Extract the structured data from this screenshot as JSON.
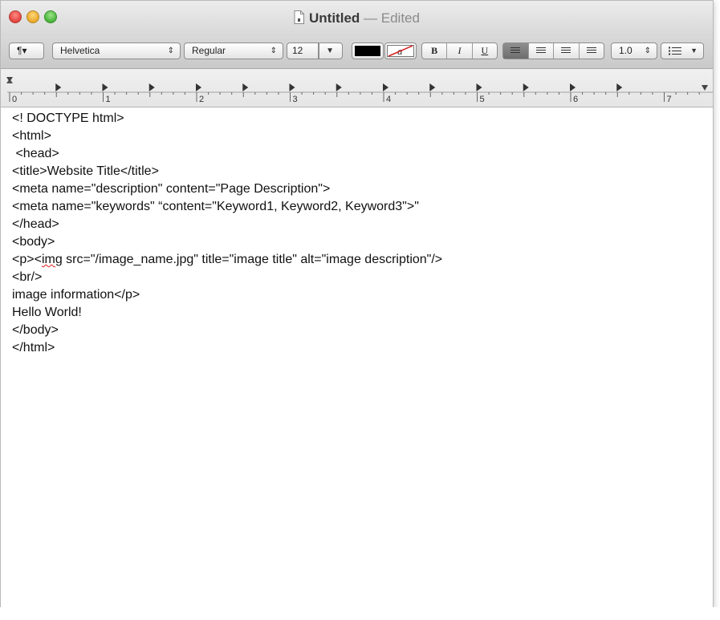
{
  "window": {
    "title": "Untitled",
    "separator": "—",
    "status": "Edited"
  },
  "toolbar": {
    "paragraph_button": "¶▾",
    "font_family": "Helvetica",
    "font_style": "Regular",
    "font_size": "12",
    "bold": "B",
    "italic": "I",
    "underline": "U",
    "line_spacing": "1.0",
    "text_color": "#000000",
    "selected_alignment": "left"
  },
  "ruler": {
    "labels": [
      "0",
      "1",
      "2",
      "3",
      "4",
      "5",
      "6",
      "7"
    ]
  },
  "document": {
    "lines": [
      "<! DOCTYPE html>",
      "<html>",
      " <head>",
      "<title>Website Title</title>",
      "<meta name=\"description\" content=\"Page Description\">",
      "<meta name=\"keywords\" “content=\"Keyword1, Keyword2, Keyword3\">\"",
      "</head>",
      "<body>",
      "<p><",
      "img",
      " src=\"/image_name.jpg\" title=\"image title\" alt=\"image description\"/>",
      "<br/>",
      "image information</p>",
      "Hello World!",
      "</body>",
      "</html>"
    ]
  }
}
